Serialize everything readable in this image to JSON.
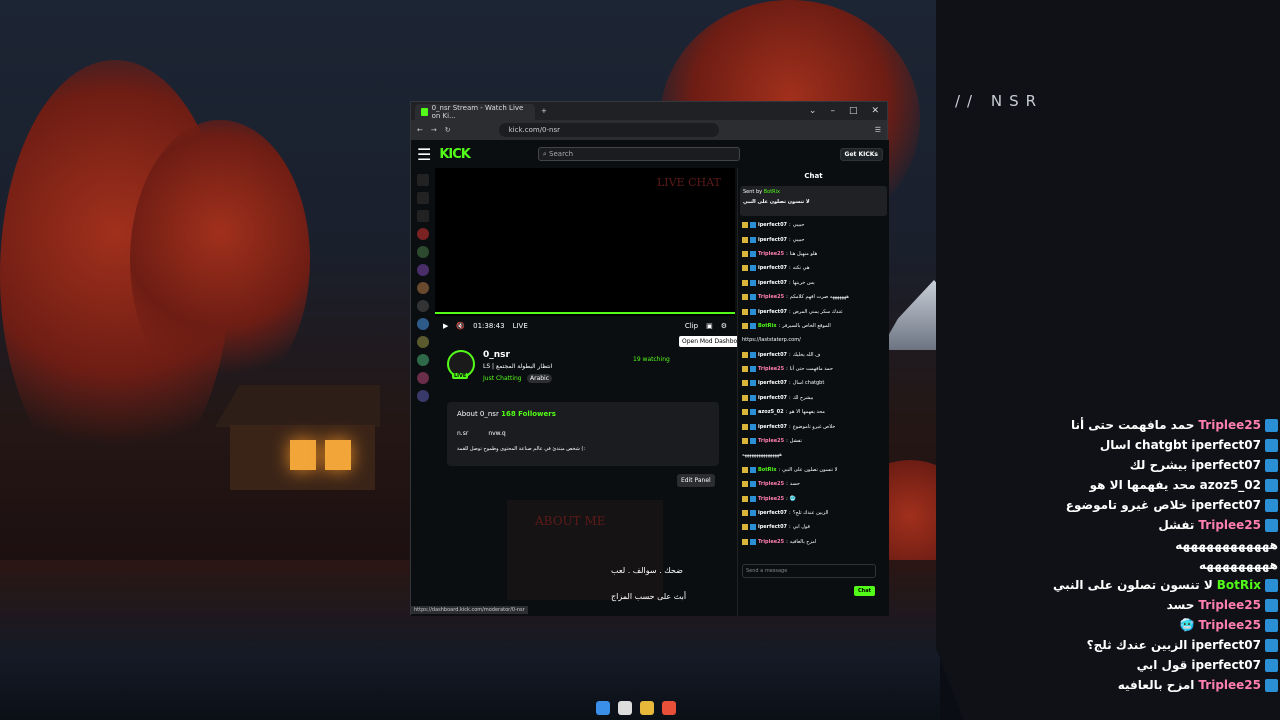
{
  "desktop": {
    "overlay_title": "// NSR"
  },
  "overlay_chat": [
    {
      "user": "Triplee25",
      "color": "pink",
      "message": "حمد مافهمت حتى أنا"
    },
    {
      "user": "iperfect07",
      "color": "white",
      "message": "اسال chatgbt"
    },
    {
      "user": "iperfect07",
      "color": "white",
      "message": "بيشرح لك"
    },
    {
      "user": "azoz5_02",
      "color": "white",
      "message": "محد يفهمها الا هو"
    },
    {
      "user": "iperfect07",
      "color": "white",
      "message": "خلاص غيرو تاموضوع"
    },
    {
      "user": "Triplee25",
      "color": "pink",
      "message": "تفشل"
    },
    {
      "user": "",
      "color": "white",
      "message": "ههههههههههههه"
    },
    {
      "user": "",
      "color": "white",
      "message": "هههههههههه"
    },
    {
      "user": "BotRix",
      "color": "green",
      "message": "لا تنسون تصلون على النبي"
    },
    {
      "user": "Triplee25",
      "color": "pink",
      "message": "حسد"
    },
    {
      "user": "Triplee25",
      "color": "pink",
      "message": "🥶"
    },
    {
      "user": "iperfect07",
      "color": "white",
      "message": "الزبين عندك ثلج؟"
    },
    {
      "user": "iperfect07",
      "color": "white",
      "message": "قول ابي"
    },
    {
      "user": "Triplee25",
      "color": "pink",
      "message": "امزح بالعافيه"
    }
  ],
  "browser": {
    "tab_title": "0_nsr Stream - Watch Live on Ki...",
    "url": "kick.com/0-nsr",
    "status_url": "https://dashboard.kick.com/moderator/0-nsr"
  },
  "kick": {
    "logo": "KICK",
    "search_placeholder": "Search",
    "get_kicks": "Get KICKs",
    "video": {
      "time": "01:38:43",
      "live": "LIVE",
      "clip": "Clip",
      "tooltip": "Open Mod Dashboard",
      "overlay_text": "LIVE CHAT"
    },
    "channel": {
      "name": "0_nsr",
      "title": "LS | انتظار البطولة المجتمع",
      "category": "Just Chatting",
      "language": "Arabic",
      "watching": "19 watching",
      "live_badge": "LIVE"
    },
    "about": {
      "heading": "About 0_nsr",
      "followers": "168 Followers",
      "discord": "n.sr",
      "tiktok": "nvw.q",
      "description": "شخص مبتدئ في عالم صناعة المحتوى وطموح توصل للقمة (:"
    },
    "edit_panel": "Edit Panel",
    "about_me_panel": "ABOUT ME",
    "panel_line1": "ضحك . سوالف . لعب",
    "panel_line2": "أبث على حسب المزاج",
    "chat": {
      "header": "Chat",
      "pinned_by": "Sent by",
      "pinned_user": "BotRix",
      "pinned_msg": "لا تنسون تصلون على النبي",
      "input_placeholder": "Send a message",
      "send": "Chat",
      "messages": [
        {
          "user": "iperfect07",
          "color": "white",
          "message": "حبيبي"
        },
        {
          "user": "iperfect07",
          "color": "white",
          "message": "حبيبي"
        },
        {
          "user": "Triplee25",
          "color": "pink",
          "message": "هلو منهيل هنا"
        },
        {
          "user": "iperfect07",
          "color": "white",
          "message": "هي نكته"
        },
        {
          "user": "iperfect07",
          "color": "white",
          "message": "بس خربتها"
        },
        {
          "user": "Triplee25",
          "color": "pink",
          "message": "هههههههه صرت افهم كلامكم"
        },
        {
          "user": "iperfect07",
          "color": "white",
          "message": "عندك سكر يمني المرض"
        },
        {
          "user": "BotRix",
          "color": "green",
          "message": "الموقع الخاص بالسيرفر"
        },
        {
          "user": "",
          "color": "white",
          "message": "https://laststaterp.com/"
        },
        {
          "user": "iperfect07",
          "color": "white",
          "message": "ف الله يخليك"
        },
        {
          "user": "Triplee25",
          "color": "pink",
          "message": "حمد مافهمت حتى أنا"
        },
        {
          "user": "iperfect07",
          "color": "white",
          "message": "اسال chatgbt"
        },
        {
          "user": "iperfect07",
          "color": "white",
          "message": "بيشرح لك"
        },
        {
          "user": "azoz5_02",
          "color": "white",
          "message": "محد يفهمها الا هو"
        },
        {
          "user": "iperfect07",
          "color": "white",
          "message": "خلاص غيرو تاموضوع"
        },
        {
          "user": "Triplee25",
          "color": "pink",
          "message": "تفشل"
        },
        {
          "user": "",
          "color": "white",
          "message": "ههههههههههههههههه"
        },
        {
          "user": "BotRix",
          "color": "green",
          "message": "لا تنسون تصلون على النبي"
        },
        {
          "user": "Triplee25",
          "color": "pink",
          "message": "حسد"
        },
        {
          "user": "Triplee25",
          "color": "pink",
          "message": "🥶"
        },
        {
          "user": "iperfect07",
          "color": "white",
          "message": "الزبين عندك ثلج؟"
        },
        {
          "user": "iperfect07",
          "color": "white",
          "message": "قول ابي"
        },
        {
          "user": "Triplee25",
          "color": "pink",
          "message": "امزح بالعافيه"
        }
      ]
    }
  },
  "colors": {
    "accent": "#53fc18",
    "pink": "#ff7fb0",
    "badge_blue": "#2b8fd6"
  }
}
